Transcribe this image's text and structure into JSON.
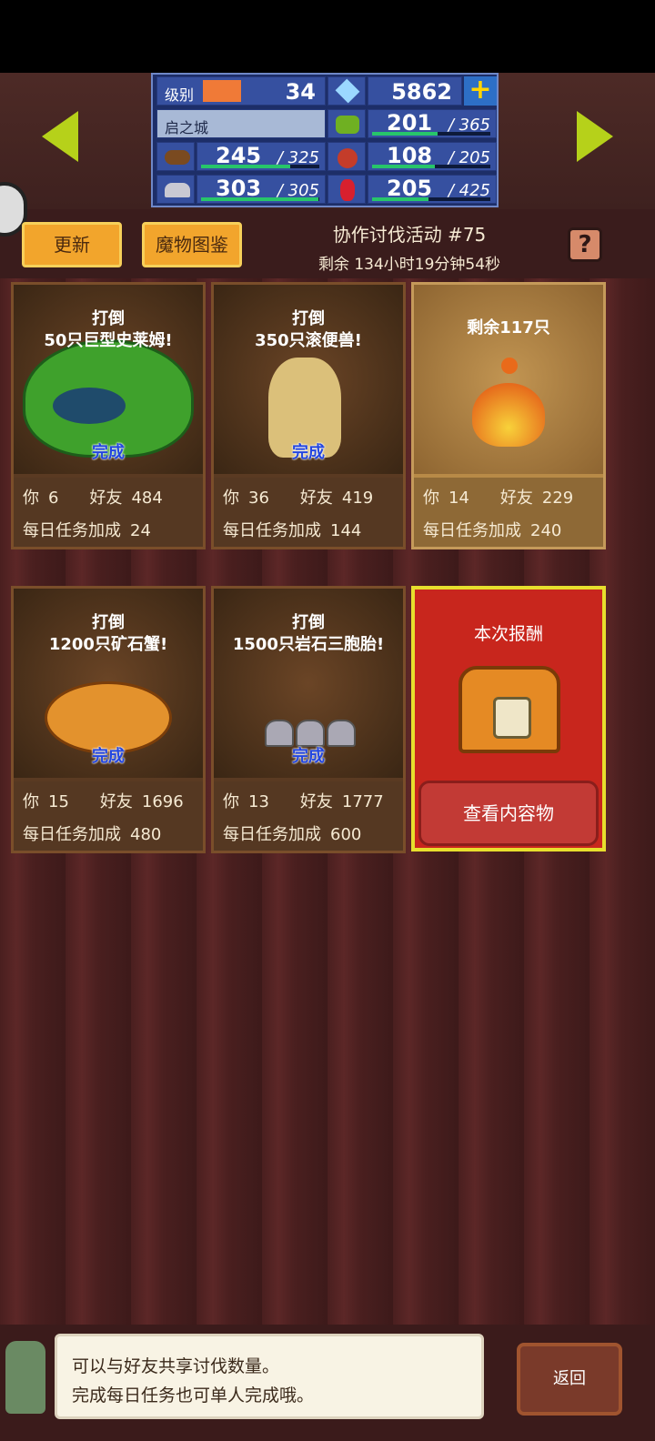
{
  "resources": {
    "level_label": "级别",
    "level": "34",
    "gems": "5862",
    "town_name": "启之城",
    "grass_current": "201",
    "grass_max": "/ 365",
    "wood_current": "245",
    "wood_max": "/ 325",
    "food_current": "108",
    "food_max": "/ 205",
    "ore_current": "303",
    "ore_max": "/ 305",
    "ruby_current": "205",
    "ruby_max": "/ 425"
  },
  "buttons": {
    "refresh": "更新",
    "bestiary": "魔物图鉴",
    "help": "?",
    "view_contents": "查看内容物",
    "back": "返回"
  },
  "event": {
    "title": "协作讨伐活动 #75",
    "remaining": "剩余 134小时19分钟54秒"
  },
  "cards": [
    {
      "task": "打倒\n50只巨型史莱姆!",
      "done": "完成",
      "you_label": "你",
      "you": "6",
      "friends_label": "好友",
      "friends": "484",
      "daily_label": "每日任务加成",
      "daily": "24"
    },
    {
      "task": "打倒\n350只滚便兽!",
      "done": "完成",
      "you_label": "你",
      "you": "36",
      "friends_label": "好友",
      "friends": "419",
      "daily_label": "每日任务加成",
      "daily": "144"
    },
    {
      "task": "剩余117只",
      "done": "",
      "you_label": "你",
      "you": "14",
      "friends_label": "好友",
      "friends": "229",
      "daily_label": "每日任务加成",
      "daily": "240"
    },
    {
      "task": "打倒\n1200只矿石蟹!",
      "done": "完成",
      "you_label": "你",
      "you": "15",
      "friends_label": "好友",
      "friends": "1696",
      "daily_label": "每日任务加成",
      "daily": "480"
    },
    {
      "task": "打倒\n1500只岩石三胞胎!",
      "done": "完成",
      "you_label": "你",
      "you": "13",
      "friends_label": "好友",
      "friends": "1777",
      "daily_label": "每日任务加成",
      "daily": "600"
    }
  ],
  "reward": {
    "title": "本次报酬"
  },
  "tip": {
    "line1": "可以与好友共享讨伐数量。",
    "line2": "完成每日任务也可单人完成哦。"
  }
}
